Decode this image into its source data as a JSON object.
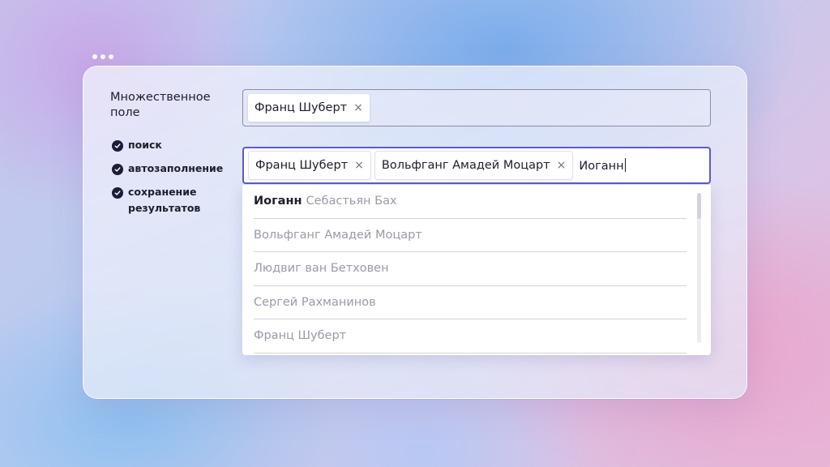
{
  "panel": {
    "title": "Множественное поле",
    "features": [
      {
        "label": "поиск",
        "icon": "check-circle-icon"
      },
      {
        "label": "автозаполнение",
        "icon": "check-circle-icon"
      },
      {
        "label": "сохранение результатов",
        "icon": "check-circle-icon"
      }
    ]
  },
  "field_single": {
    "chips": [
      {
        "label": "Франц Шуберт",
        "remove": "×"
      }
    ]
  },
  "field_multi": {
    "chips": [
      {
        "label": "Франц Шуберт",
        "remove": "×"
      },
      {
        "label": "Вольфганг Амадей Моцарт",
        "remove": "×"
      }
    ],
    "query": "Иоганн"
  },
  "dropdown": {
    "options": [
      {
        "match": "Иоганн",
        "rest": "Себастьян Бах"
      },
      {
        "match": "",
        "rest": "Вольфганг Амадей Моцарт"
      },
      {
        "match": "",
        "rest": "Людвиг ван Бетховен"
      },
      {
        "match": "",
        "rest": "Сергей Рахманинов"
      },
      {
        "match": "",
        "rest": "Франц Шуберт"
      }
    ]
  },
  "colors": {
    "focus_border": "#5d5ac8",
    "check_fill": "#1b1b3a",
    "text_primary": "#1d1d2c",
    "text_muted": "#9a9aa8"
  }
}
